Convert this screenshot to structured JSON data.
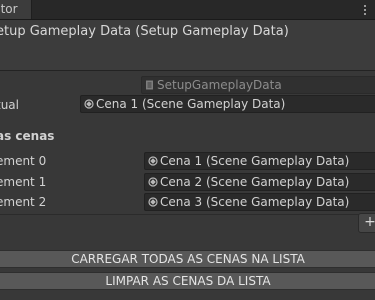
{
  "tab": {
    "label": "ctor"
  },
  "header": {
    "title": "etup Gameplay Data (Setup Gameplay Data)"
  },
  "script_field": {
    "value": "SetupGameplayData",
    "icon": "script-file-icon"
  },
  "current": {
    "label": "tual",
    "value": "Cena 1 (Scene Gameplay Data)",
    "icon": "scriptable-object-icon"
  },
  "scenes_section": {
    "label": "as cenas"
  },
  "elements": [
    {
      "label": "ement 0",
      "value": "Cena 1 (Scene Gameplay Data)"
    },
    {
      "label": "ement 1",
      "value": "Cena 2 (Scene Gameplay Data)"
    },
    {
      "label": "ement 2",
      "value": "Cena 3 (Scene Gameplay Data)"
    }
  ],
  "add_button": {
    "label": "+"
  },
  "buttons": {
    "load_all": "CARREGAR TODAS AS CENAS NA LISTA",
    "clear": "LIMPAR AS CENAS DA LISTA"
  },
  "colors": {
    "background": "#383838",
    "field": "#2a2a2a",
    "button": "#585858"
  }
}
